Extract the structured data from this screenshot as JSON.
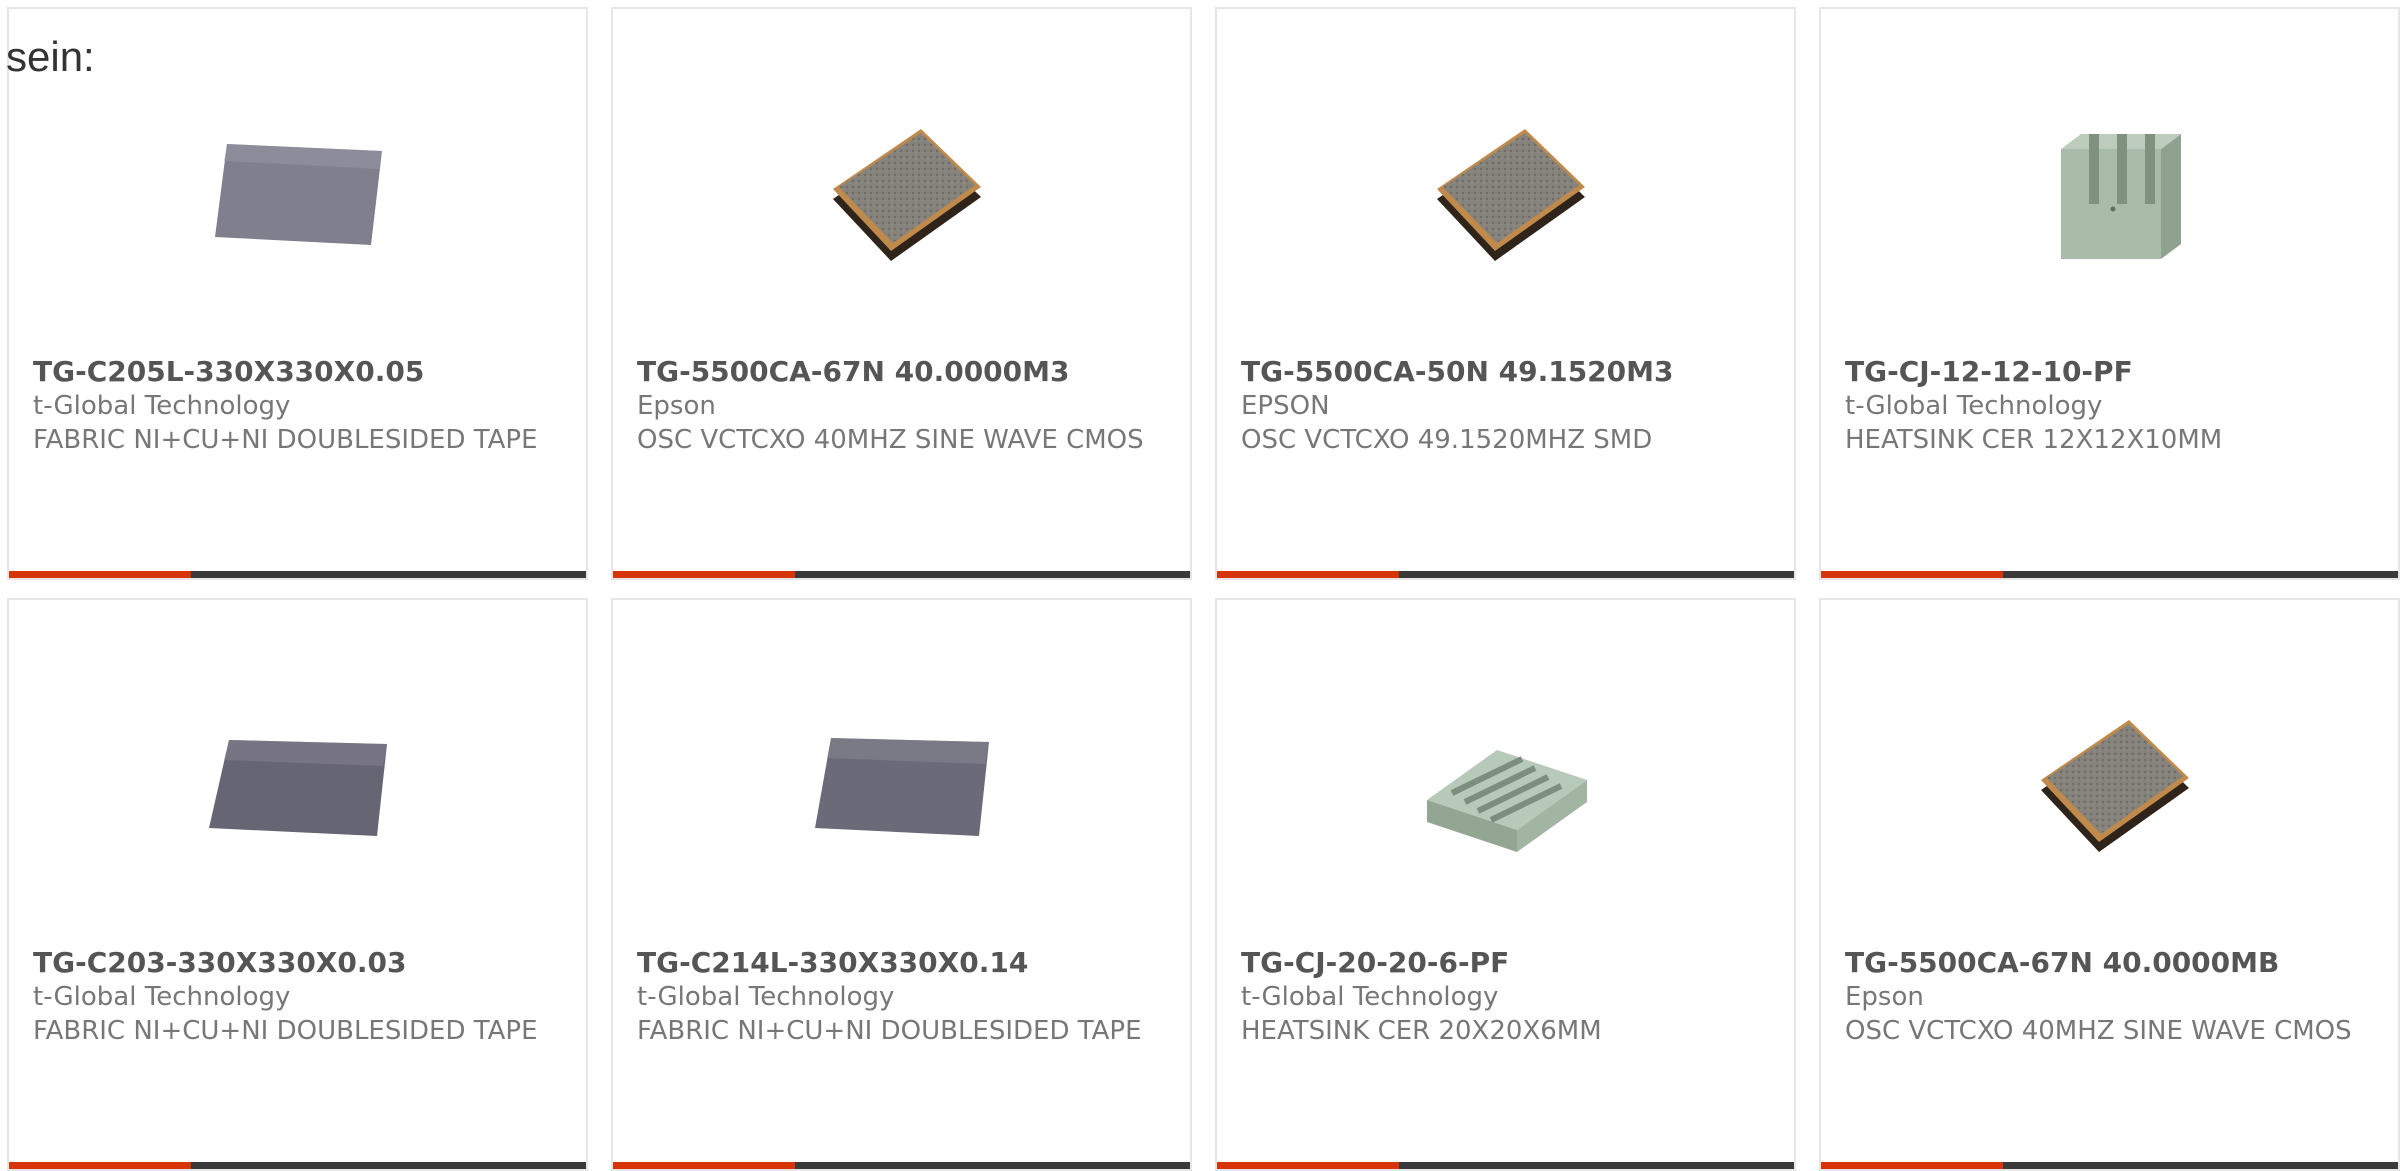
{
  "intro_text": "sein:",
  "colors": {
    "accent": "#d8340a",
    "bar": "#3a3a3a",
    "border": "#e6e6e6",
    "title": "#555555",
    "text": "#777777"
  },
  "products": [
    {
      "part_number": "TG-C205L-330X330X0.05",
      "manufacturer": "t-Global Technology",
      "description": "FABRIC NI+CU+NI DOUBLESIDED TAPE",
      "icon": "fabric-tape-sheet-icon"
    },
    {
      "part_number": "TG-5500CA-67N 40.0000M3",
      "manufacturer": "Epson",
      "description": "OSC VCTCXO 40MHZ SINE WAVE CMOS",
      "icon": "oscillator-chip-icon"
    },
    {
      "part_number": "TG-5500CA-50N 49.1520M3",
      "manufacturer": "EPSON",
      "description": "OSC VCTCXO 49.1520MHZ SMD",
      "icon": "oscillator-chip-icon"
    },
    {
      "part_number": "TG-CJ-12-12-10-PF",
      "manufacturer": "t-Global Technology",
      "description": "HEATSINK CER 12X12X10MM",
      "icon": "ceramic-heatsink-icon"
    },
    {
      "part_number": "TG-C203-330X330X0.03",
      "manufacturer": "t-Global Technology",
      "description": "FABRIC NI+CU+NI DOUBLESIDED TAPE",
      "icon": "fabric-tape-sheet-icon"
    },
    {
      "part_number": "TG-C214L-330X330X0.14",
      "manufacturer": "t-Global Technology",
      "description": "FABRIC NI+CU+NI DOUBLESIDED TAPE",
      "icon": "fabric-tape-sheet-icon"
    },
    {
      "part_number": "TG-CJ-20-20-6-PF",
      "manufacturer": "t-Global Technology",
      "description": "HEATSINK CER 20X20X6MM",
      "icon": "ceramic-heatsink-flat-icon"
    },
    {
      "part_number": "TG-5500CA-67N 40.0000MB",
      "manufacturer": "Epson",
      "description": "OSC VCTCXO 40MHZ SINE WAVE CMOS",
      "icon": "oscillator-chip-icon"
    }
  ]
}
